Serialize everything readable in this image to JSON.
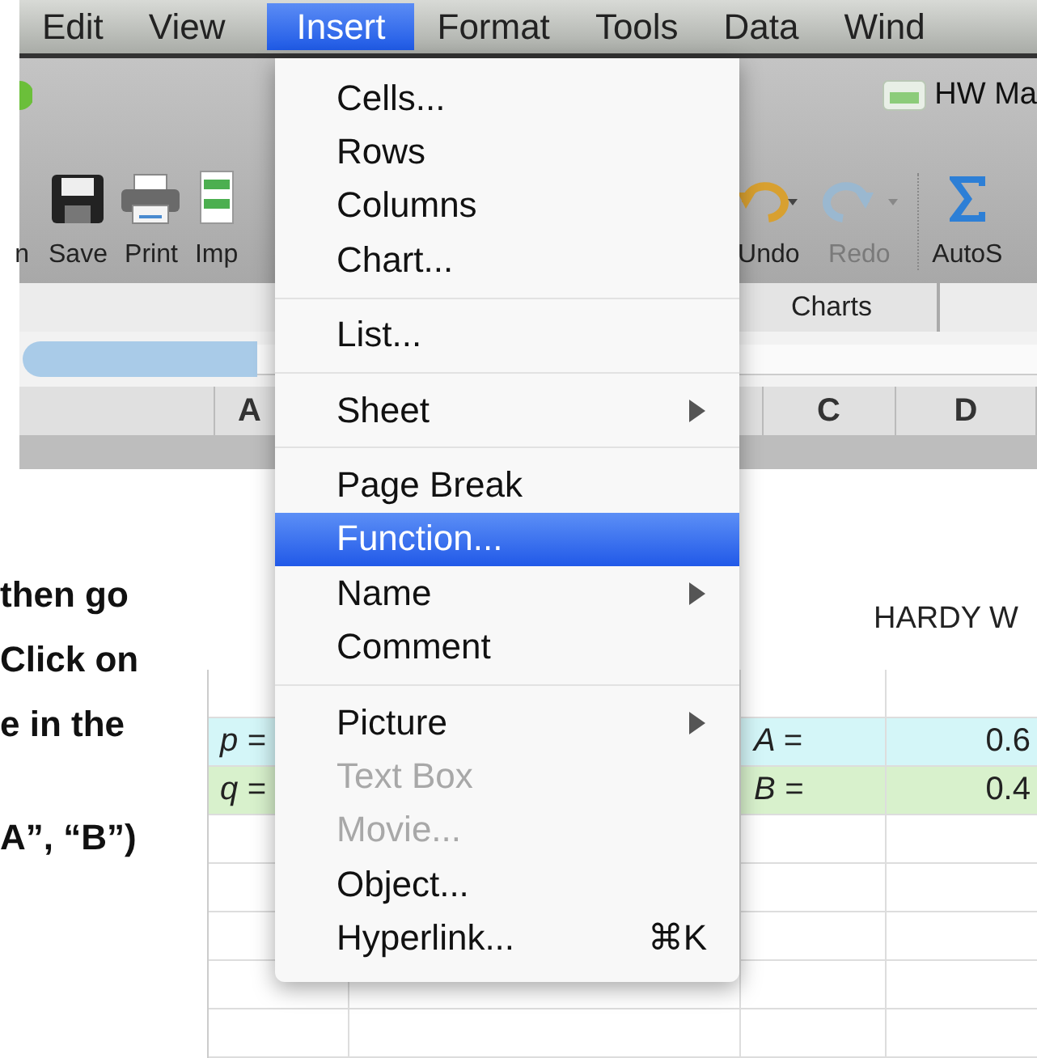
{
  "menu_bar": [
    {
      "label": "Edit",
      "selected": false
    },
    {
      "label": "View",
      "selected": false
    },
    {
      "label": "Insert",
      "selected": true
    },
    {
      "label": "Format",
      "selected": false
    },
    {
      "label": "Tools",
      "selected": false
    },
    {
      "label": "Data",
      "selected": false
    },
    {
      "label": "Wind",
      "selected": false
    }
  ],
  "window_title": "HW Ma",
  "toolbar": [
    {
      "kind": "label",
      "label": "n",
      "disabled": false
    },
    {
      "kind": "save",
      "label": "Save",
      "disabled": false
    },
    {
      "kind": "print",
      "label": "Print",
      "disabled": false
    },
    {
      "kind": "import",
      "label": "Imp",
      "disabled": false
    },
    {
      "kind": "undo",
      "label": "Undo",
      "disabled": false
    },
    {
      "kind": "redo",
      "label": "Redo",
      "disabled": true
    },
    {
      "kind": "autosum",
      "label": "AutoS",
      "disabled": false
    }
  ],
  "ribbon_tabs": [
    {
      "label": "Charts"
    }
  ],
  "column_headers": [
    "A",
    "C",
    "D"
  ],
  "menu": [
    {
      "kind": "item",
      "label": "Cells...",
      "submenu": false,
      "disabled": false,
      "selected": false
    },
    {
      "kind": "item",
      "label": "Rows",
      "submenu": false,
      "disabled": false,
      "selected": false
    },
    {
      "kind": "item",
      "label": "Columns",
      "submenu": false,
      "disabled": false,
      "selected": false
    },
    {
      "kind": "item",
      "label": "Chart...",
      "submenu": false,
      "disabled": false,
      "selected": false
    },
    {
      "kind": "separator"
    },
    {
      "kind": "item",
      "label": "List...",
      "submenu": false,
      "disabled": false,
      "selected": false
    },
    {
      "kind": "separator"
    },
    {
      "kind": "item",
      "label": "Sheet",
      "submenu": true,
      "disabled": false,
      "selected": false
    },
    {
      "kind": "separator"
    },
    {
      "kind": "item",
      "label": "Page Break",
      "submenu": false,
      "disabled": false,
      "selected": false
    },
    {
      "kind": "item",
      "label": "Function...",
      "submenu": false,
      "disabled": false,
      "selected": true
    },
    {
      "kind": "item",
      "label": "Name",
      "submenu": true,
      "disabled": false,
      "selected": false
    },
    {
      "kind": "item",
      "label": "Comment",
      "submenu": false,
      "disabled": false,
      "selected": false
    },
    {
      "kind": "separator"
    },
    {
      "kind": "item",
      "label": "Picture",
      "submenu": true,
      "disabled": false,
      "selected": false
    },
    {
      "kind": "item",
      "label": "Text Box",
      "submenu": false,
      "disabled": true,
      "selected": false
    },
    {
      "kind": "item",
      "label": "Movie...",
      "submenu": false,
      "disabled": true,
      "selected": false
    },
    {
      "kind": "item",
      "label": "Object...",
      "submenu": false,
      "disabled": false,
      "selected": false
    },
    {
      "kind": "item",
      "label": "Hyperlink...",
      "shortcut": "⌘K",
      "submenu": false,
      "disabled": false,
      "selected": false
    }
  ],
  "slide_text": [
    "then go",
    "Click on",
    "e in the",
    "A”, “B”)"
  ],
  "sheet": {
    "heading": "HARDY W",
    "rows": [
      {
        "label": "p =",
        "name": "A =",
        "value": "0.6",
        "color": "#d4f6f8"
      },
      {
        "label": "q =",
        "name": "B =",
        "value": "0.4",
        "color": "#d8f1cc"
      }
    ]
  }
}
